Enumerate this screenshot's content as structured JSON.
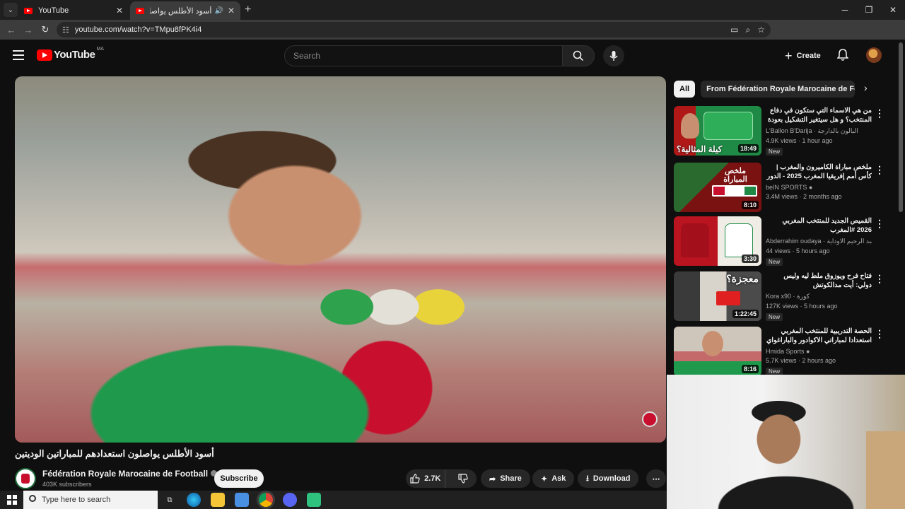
{
  "browser": {
    "tabs": [
      {
        "title": "YouTube"
      },
      {
        "title": "أسود الأطلس يواصلون استعدادهم للمباريات الوديتين"
      }
    ],
    "url": "youtube.com/watch?v=TMpu8fPK4i4"
  },
  "youtube": {
    "logo_text": "YouTube",
    "country_code": "MA",
    "search_placeholder": "Search",
    "create_label": "Create"
  },
  "video": {
    "title": "أسود الأطلس يواصلون استعدادهم للمباراتين الوديتين",
    "channel": "Fédération Royale Marocaine de Football",
    "subscribers": "403K subscribers",
    "subscribe_label": "Subscribe",
    "likes": "2.7K",
    "share_label": "Share",
    "ask_label": "Ask",
    "download_label": "Download"
  },
  "chips": [
    {
      "label": "All"
    },
    {
      "label": "From Fédération Royale Marocaine de Football"
    }
  ],
  "recommendations": [
    {
      "title": "من هي الاسماء التي ستكون في دفاع المنتخب؟ و هل سيتغير التشكيل بعودة وهبي؟",
      "channel": "L'Ballon B'Darija · البالون بالدارجة",
      "stats": "4.9K views · 1 hour ago",
      "badge": "New",
      "duration": "18:49",
      "thumb_text": "كيلة المثالية؟"
    },
    {
      "title": "ملخص مباراة الكاميرون والمغرب | كأس أمم إفريقيا المغرب 2025 - الدور ربع النهائي",
      "channel": "beIN SPORTS",
      "stats": "3.4M views · 2 months ago",
      "badge": "",
      "duration": "8:10",
      "thumb_text": "ملخص المباراة"
    },
    {
      "title": "القميص الجديد للمنتخب المغربي 2026 #المغرب Abderrahimoudaya@ ...",
      "channel": "Abderrahim oudaya · عبد الرحيم الاوداية",
      "stats": "44 views · 5 hours ago",
      "badge": "New",
      "duration": "3:30",
      "thumb_text": ""
    },
    {
      "title": "فتاح فرح ويوزوق ملط ليه وليس دولي: أيت مدالكوتش طوداد'تهاشم'كاد'ليك؟",
      "channel": "Kora x90 · كورة",
      "stats": "127K views · 5 hours ago",
      "badge": "New",
      "duration": "1:22:45",
      "thumb_text": "معجزة؟"
    },
    {
      "title": "الحصة التدريبية للمنتخب المغربي استعدادا لمباراتي الاكوادور والباراغواي",
      "channel": "Hmida Sports",
      "stats": "5.7K views · 2 hours ago",
      "badge": "New",
      "duration": "8:16",
      "thumb_text": ""
    }
  ],
  "taskbar": {
    "search_placeholder": "Type here to search"
  },
  "colors": {
    "yt_red": "#ff0000",
    "morocco_red": "#c8102e",
    "morocco_green": "#1e8a45"
  }
}
